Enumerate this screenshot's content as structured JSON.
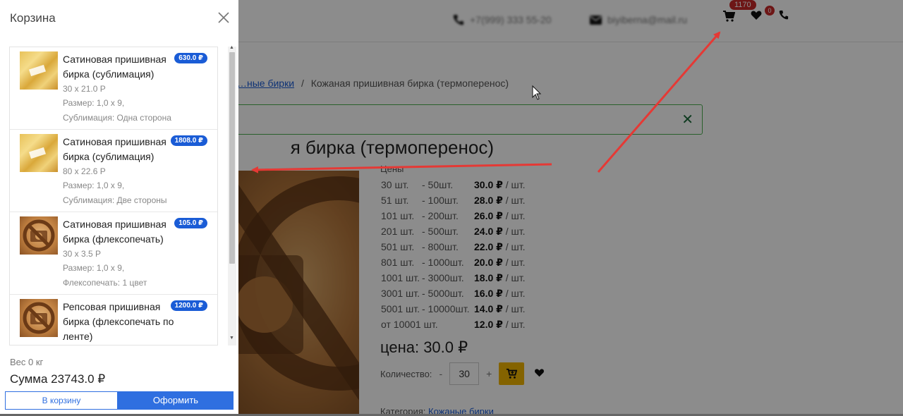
{
  "header": {
    "phone": "+7(999) 333 55-20",
    "email": "biyiberna@mail.ru",
    "cart_badge": "1170",
    "favorites_badge": "0"
  },
  "breadcrumb": {
    "parent_link": "…ные бирки",
    "separator": "/",
    "current": "Кожаная пришивная бирка (термоперенос)"
  },
  "product": {
    "title_visible": "я бирка (термоперенос)",
    "prices_caption": "Цены",
    "price_rows": [
      {
        "from": "30 шт.",
        "to": "- 50шт.",
        "price": "30.0 ₽",
        "unit": "/ шт."
      },
      {
        "from": "51 шт.",
        "to": "- 100шт.",
        "price": "28.0 ₽",
        "unit": "/ шт."
      },
      {
        "from": "101 шт.",
        "to": "- 200шт.",
        "price": "26.0 ₽",
        "unit": "/ шт."
      },
      {
        "from": "201 шт.",
        "to": "- 500шт.",
        "price": "24.0 ₽",
        "unit": "/ шт."
      },
      {
        "from": "501 шт.",
        "to": "- 800шт.",
        "price": "22.0 ₽",
        "unit": "/ шт."
      },
      {
        "from": "801 шт.",
        "to": "- 1000шт.",
        "price": "20.0 ₽",
        "unit": "/ шт."
      },
      {
        "from": "1001 шт.",
        "to": "- 3000шт.",
        "price": "18.0 ₽",
        "unit": "/ шт."
      },
      {
        "from": "3001 шт.",
        "to": "- 5000шт.",
        "price": "16.0 ₽",
        "unit": "/ шт."
      },
      {
        "from": "5001 шт.",
        "to": "- 10000шт.",
        "price": "14.0 ₽",
        "unit": "/ шт."
      },
      {
        "from": "от 10001 шт.",
        "to": "",
        "price": "12.0 ₽",
        "unit": "/ шт."
      }
    ],
    "price_label": "цена: 30.0 ₽",
    "quantity_label": "Количество:",
    "quantity_value": "30",
    "minus": "-",
    "plus": "+",
    "category_label": "Категория:",
    "category_link": "Кожаные бирки"
  },
  "cart": {
    "title": "Корзина",
    "items": [
      {
        "name": "Сатиновая пришивная бирка (сублимация)",
        "price": "630.0 ₽",
        "dims": "30 x 21.0 Р",
        "size": "Размер: 1,0 x 9,",
        "option": "Сублимация: Одна сторона",
        "thumb": "satin"
      },
      {
        "name": "Сатиновая пришивная бирка (сублимация)",
        "price": "1808.0 ₽",
        "dims": "80 x 22.6 Р",
        "size": "Размер: 1,0 x 9,",
        "option": "Сублимация: Две стороны",
        "thumb": "satin"
      },
      {
        "name": "Сатиновая пришивная бирка (флексопечать)",
        "price": "105.0 ₽",
        "dims": "30 x 3.5 Р",
        "size": "Размер: 1,0 x 9,",
        "option": "Флексопечать: 1 цвет",
        "thumb": "noimg"
      },
      {
        "name": "Репсовая пришивная бирка (флексопечать по ленте)",
        "price": "1200.0 ₽",
        "dims": "",
        "size": "",
        "option": "",
        "thumb": "noimg"
      }
    ],
    "weight": "Вес 0 кг",
    "total": "Сумма 23743.0 ₽",
    "to_cart_label": "В корзину",
    "order_label": "Оформить"
  },
  "colors": {
    "accent_blue": "#2f6fe0",
    "badge_red": "#c62828",
    "annotation_arrow": "#e53935",
    "add_to_cart_yellow": "#f0b400"
  }
}
